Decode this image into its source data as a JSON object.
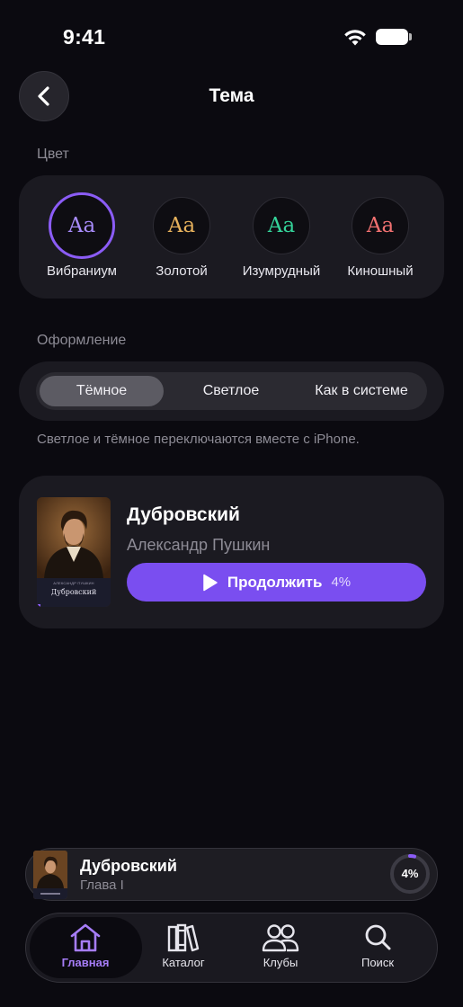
{
  "status_bar": {
    "time": "9:41"
  },
  "header": {
    "title": "Тема"
  },
  "color_section": {
    "label": "Цвет",
    "options": [
      {
        "glyph": "Aa",
        "label": "Вибраниум",
        "color": "#a78bfa",
        "selected": true
      },
      {
        "glyph": "Aa",
        "label": "Золотой",
        "color": "#e6b15c",
        "selected": false
      },
      {
        "glyph": "Aa",
        "label": "Изумрудный",
        "color": "#34d399",
        "selected": false
      },
      {
        "glyph": "Aa",
        "label": "Киношный",
        "color": "#f07070",
        "selected": false
      }
    ]
  },
  "appearance_section": {
    "label": "Оформление",
    "options": [
      "Тёмное",
      "Светлое",
      "Как в системе"
    ],
    "selected": "Тёмное",
    "hint": "Светлое и тёмное переключаются вместе с iPhone."
  },
  "book_card": {
    "cover_author": "АЛЕКСАНДР ПУШКИН",
    "cover_title": "Дубровский",
    "title": "Дубровский",
    "author": "Александр Пушкин",
    "continue_label": "Продолжить",
    "progress": "4%"
  },
  "mini_player": {
    "title": "Дубровский",
    "subtitle": "Глава I",
    "progress": "4%"
  },
  "tab_bar": {
    "items": [
      {
        "label": "Главная",
        "icon": "home-icon",
        "active": true
      },
      {
        "label": "Каталог",
        "icon": "books-icon",
        "active": false
      },
      {
        "label": "Клубы",
        "icon": "people-icon",
        "active": false
      },
      {
        "label": "Поиск",
        "icon": "search-icon",
        "active": false
      }
    ]
  },
  "colors": {
    "accent": "#7a4ef0",
    "background": "#0b0a10",
    "panel": "#1b1a21"
  }
}
